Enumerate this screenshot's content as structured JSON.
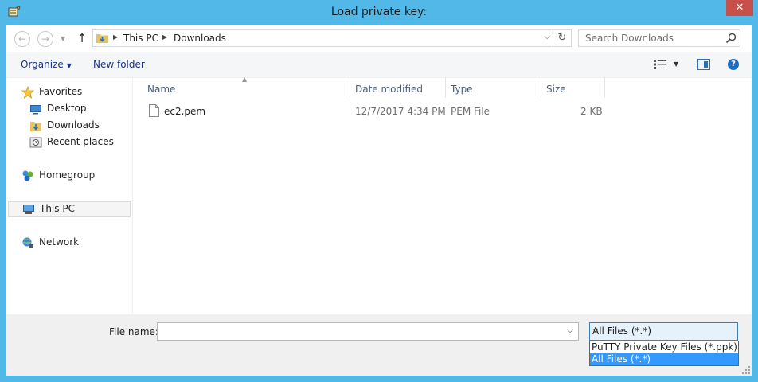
{
  "window": {
    "title": "Load private key:",
    "close_label": "✕"
  },
  "nav": {
    "back_glyph": "←",
    "forward_glyph": "→",
    "up_glyph": "↑",
    "breadcrumbs": [
      "This PC",
      "Downloads"
    ],
    "refresh_glyph": "↻",
    "search_placeholder": "Search Downloads"
  },
  "toolbar": {
    "organize_label": "Organize",
    "new_folder_label": "New folder",
    "help_glyph": "?"
  },
  "sidebar": {
    "items": [
      {
        "label": "Favorites",
        "icon": "star-icon"
      },
      {
        "label": "Desktop",
        "icon": "desktop-icon"
      },
      {
        "label": "Downloads",
        "icon": "downloads-folder-icon"
      },
      {
        "label": "Recent places",
        "icon": "recent-places-icon"
      },
      {
        "label": "Homegroup",
        "icon": "homegroup-icon"
      },
      {
        "label": "This PC",
        "icon": "computer-icon"
      },
      {
        "label": "Network",
        "icon": "network-icon"
      }
    ]
  },
  "file_list": {
    "columns": [
      "Name",
      "Date modified",
      "Type",
      "Size"
    ],
    "rows": [
      {
        "name": "ec2.pem",
        "date_modified": "12/7/2017 4:34 PM",
        "type": "PEM File",
        "size": "2 KB"
      }
    ]
  },
  "footer": {
    "file_name_label": "File name:",
    "file_name_value": "",
    "file_type_selected": "All Files (*.*)",
    "file_type_options": [
      "PuTTY Private Key Files (*.ppk)",
      "All Files (*.*)"
    ]
  },
  "colors": {
    "frame": "#52b8e8",
    "close": "#c7504b",
    "link": "#1e3287",
    "highlight": "#3399ff"
  }
}
